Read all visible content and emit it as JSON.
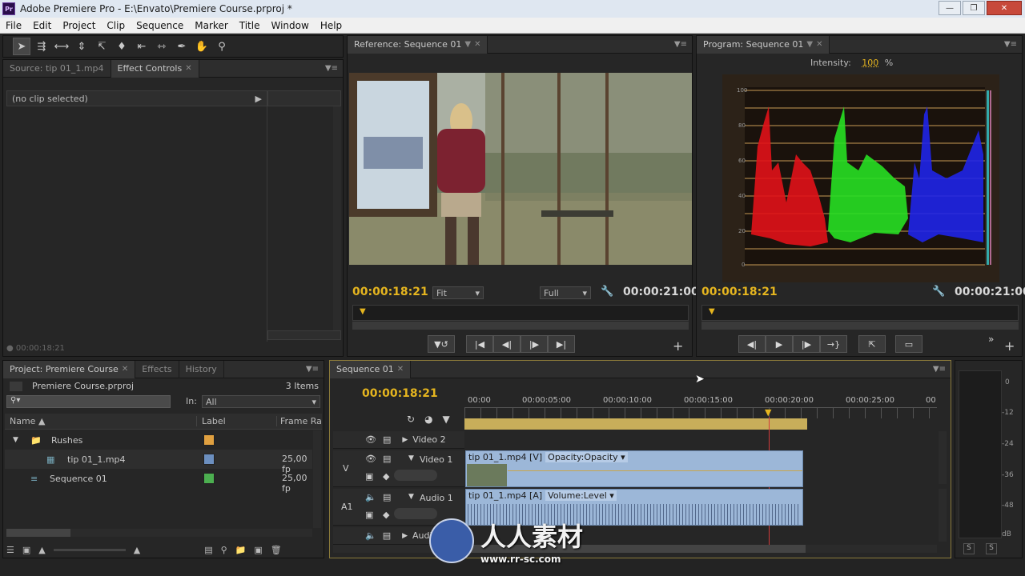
{
  "window": {
    "title": "Adobe Premiere Pro - E:\\Envato\\Premiere Course.prproj *",
    "app_icon": "Pr"
  },
  "menu": [
    "File",
    "Edit",
    "Project",
    "Clip",
    "Sequence",
    "Marker",
    "Title",
    "Window",
    "Help"
  ],
  "source_panel": {
    "tabs": [
      {
        "label": "Source: tip 01_1.mp4"
      },
      {
        "label": "Effect Controls"
      }
    ],
    "no_clip": "(no clip selected)",
    "timecode": "00:00:18:21"
  },
  "reference_monitor": {
    "tab": "Reference: Sequence 01",
    "timecode": "00:00:18:21",
    "fit": "Fit",
    "quality": "Full",
    "duration": "00:00:21:00"
  },
  "program_monitor": {
    "tab": "Program: Sequence 01",
    "intensity_label": "Intensity:",
    "intensity_value": "100",
    "intensity_unit": "%",
    "scope_labels": [
      "100",
      "80",
      "60",
      "40",
      "20",
      "0"
    ],
    "timecode": "00:00:18:21",
    "duration": "00:00:21:00"
  },
  "project_panel": {
    "tabs": [
      {
        "label": "Project: Premiere Course"
      },
      {
        "label": "Effects"
      },
      {
        "label": "History"
      }
    ],
    "project_name": "Premiere Course.prproj",
    "item_count": "3 Items",
    "in_label": "In:",
    "in_value": "All",
    "columns": {
      "name": "Name",
      "label": "Label",
      "frame_rate": "Frame Rat"
    },
    "items": [
      {
        "name": "Rushes",
        "color": "#e0a040",
        "rate": ""
      },
      {
        "name": "tip 01_1.mp4",
        "color": "#6c8fbf",
        "rate": "25,00 fp"
      },
      {
        "name": "Sequence 01",
        "color": "#4caf50",
        "rate": "25,00 fp"
      }
    ]
  },
  "timeline": {
    "tab": "Sequence 01",
    "timecode": "00:00:18:21",
    "ruler": [
      "00:00",
      "00:00:05:00",
      "00:00:10:00",
      "00:00:15:00",
      "00:00:20:00",
      "00:00:25:00",
      "00"
    ],
    "tracks": {
      "video2": "Video 2",
      "video1": "Video 1",
      "audio1": "Audio 1",
      "audio2": "Audio 2",
      "v_label": "V",
      "a_label": "A1"
    },
    "video_clip": {
      "name": "tip 01_1.mp4 [V]",
      "effect": "Opacity:Opacity"
    },
    "audio_clip": {
      "name": "tip 01_1.mp4 [A]",
      "effect": "Volume:Level"
    }
  },
  "audio_meter": {
    "labels": [
      "0",
      "-12",
      "-24",
      "-36",
      "-48",
      "dB"
    ],
    "solo": [
      "S",
      "S"
    ]
  },
  "watermark": {
    "text": "人人素材",
    "url": "www.rr-sc.com"
  }
}
